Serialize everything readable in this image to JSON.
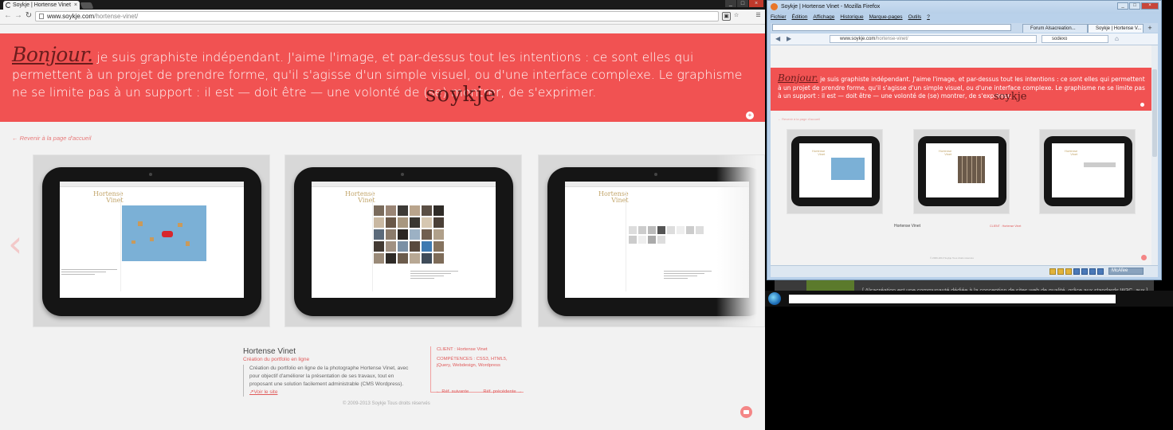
{
  "chrome": {
    "tab_title": "Soykje | Hortense Vinet",
    "tab_close": "×",
    "url_host": "www.soykje.com",
    "url_path": "/hortense-vinet/",
    "window_buttons": [
      "_",
      "□",
      "×"
    ],
    "toolbar_icons": [
      "▣",
      "☰"
    ]
  },
  "page": {
    "hero": {
      "bonjour": "Bonjour.",
      "text": " je suis graphiste indépendant. J'aime l'image, et par-dessus tout les intentions : ce sont elles qui permettent à un projet de prendre forme, qu'il s'agisse d'un simple visuel, ou d'une interface complexe. Le graphisme ne se limite pas à un support : il est — doit être — une volonté de (se) montrer, de s'exprimer.",
      "logo_word": "soykje",
      "circle_button": "+"
    },
    "back_link": "← Revenir à la page d'accueil",
    "carousel": {
      "prev_arrow": "‹",
      "next_arrow": "›",
      "slide_site_title": [
        "Hortense",
        "Vinet"
      ]
    },
    "project": {
      "title": "Hortense Vinet",
      "subtitle": "Création du portfolio en ligne",
      "description": "Création du portfolio en ligne de la photographe Hortense Vinet, avec pour objectif d'améliorer la présentation de ses travaux, tout en proposant une solution facilement administrable (CMS Wordpress).",
      "visit_link": "Voir le site",
      "client": "CLIENT : Hortense Vinet",
      "skills": "COMPÉTENCES : CSS3, HTML5, jQuery, Webdesign, Wordpress",
      "next": "← Réf. suivante",
      "prev": "Réf. précédente →"
    },
    "copyright": "© 2009-2013 Soykje Tous droits réservés"
  },
  "firefox": {
    "window_title": "Soykje | Hortense Vinet - Mozilla Firefox",
    "window_buttons": [
      "_",
      "□",
      "×"
    ],
    "menu": [
      "Fichier",
      "Édition",
      "Affichage",
      "Historique",
      "Marque-pages",
      "Outils",
      "?"
    ],
    "tabs": [
      "Forum Alsacreation...",
      "Soykje | Hortense V..."
    ],
    "new_tab": "+",
    "url_host": "www.soykje.com",
    "url_path": "/hortense-vinet/",
    "search_value": "sodexo",
    "nav_icons": [
      "◀",
      "▶",
      "⌂"
    ],
    "status_mcafee": "McAfee"
  },
  "taskbar": {
    "ticker": "[ Alsacréation est une communauté dédiée à la conception de sites web de qualité, grâce aux standards W3C, aux ]"
  }
}
